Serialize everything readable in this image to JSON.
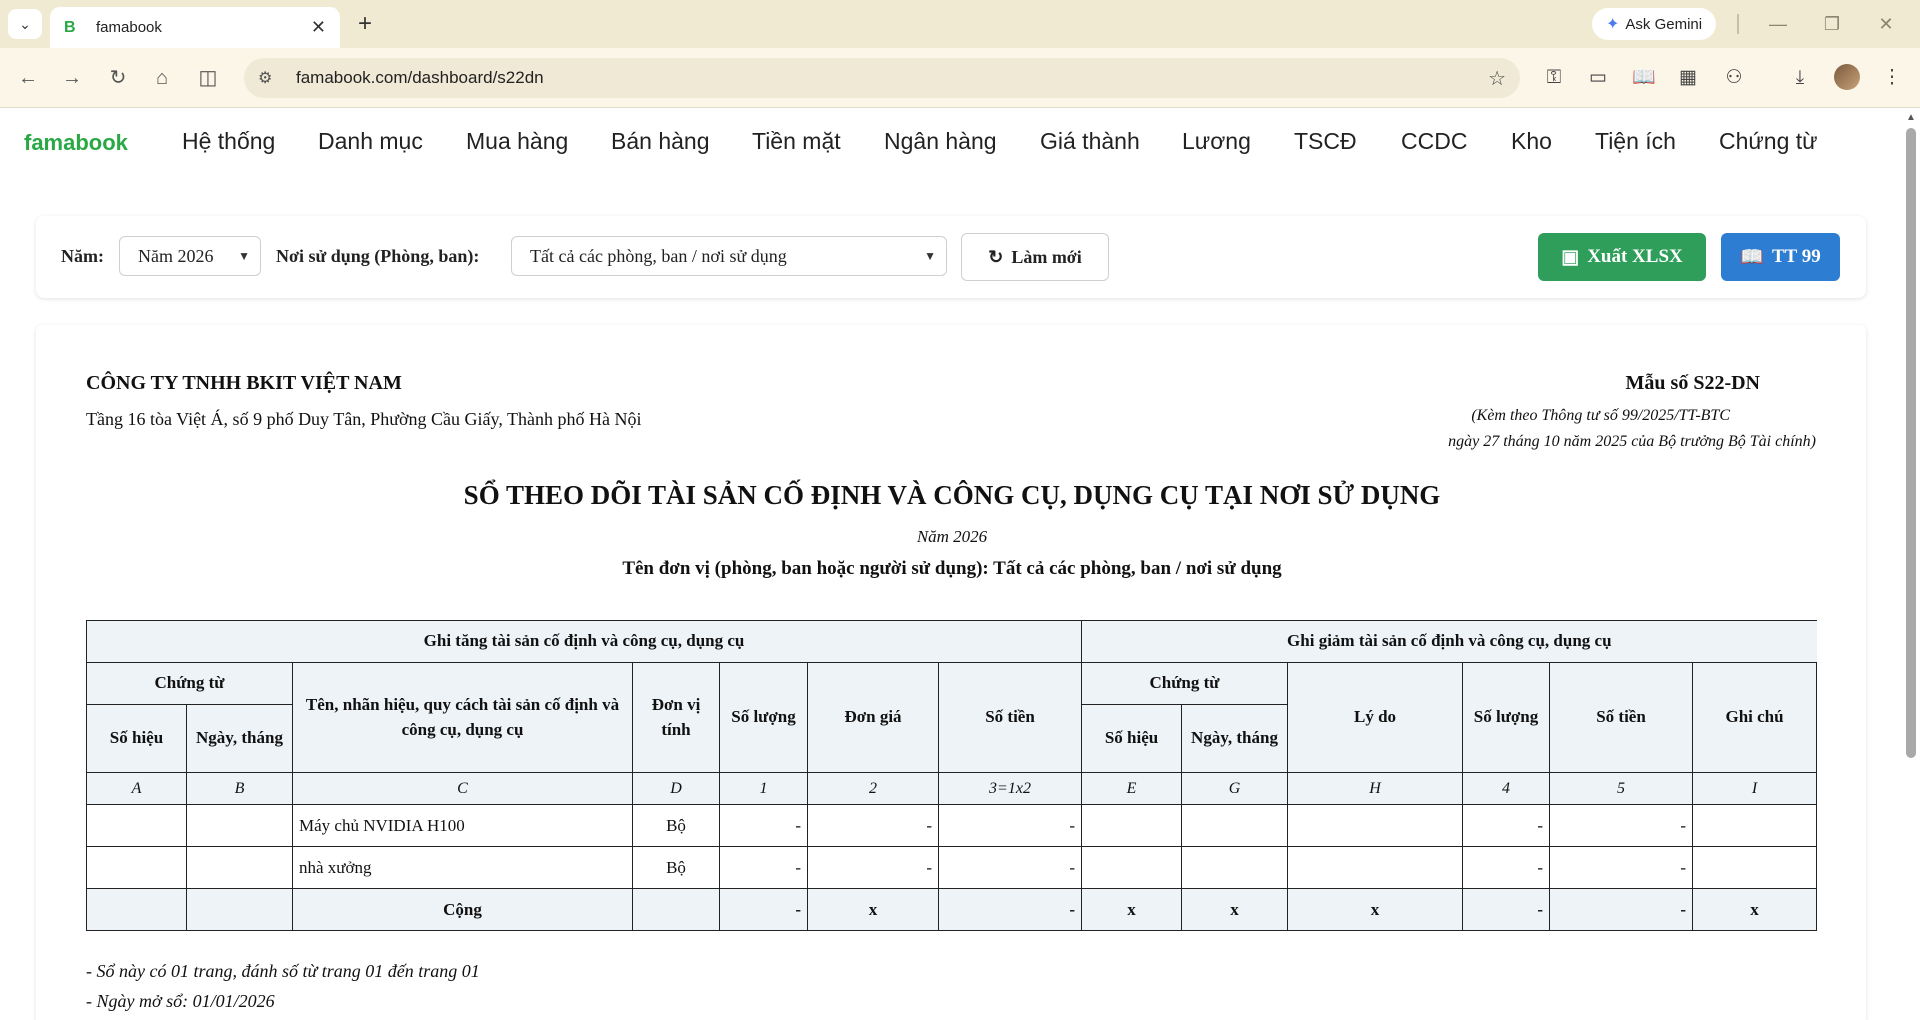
{
  "browser": {
    "tab_menu_icon": "chevron-down",
    "tab_favicon": "B",
    "tab_title": "famabook",
    "tab_close": "✕",
    "new_tab": "+",
    "gemini_label": "Ask Gemini",
    "url": "famabook.com/dashboard/s22dn"
  },
  "nav": {
    "brand": "famabook",
    "items": [
      "Hệ thống",
      "Danh mục",
      "Mua hàng",
      "Bán hàng",
      "Tiền mặt",
      "Ngân hàng",
      "Giá thành",
      "Lương",
      "TSCĐ",
      "CCDC",
      "Kho",
      "Tiện ích",
      "Chứng từ"
    ]
  },
  "filters": {
    "year_label": "Năm:",
    "year_value": "Năm 2026",
    "dept_label": "Nơi sử dụng (Phòng, ban):",
    "dept_value": "Tất cả các phòng, ban / nơi sử dụng",
    "refresh_label": "Làm mới",
    "export_label": "Xuất XLSX",
    "tt_label": "TT 99"
  },
  "report": {
    "company": "CÔNG TY TNHH BKIT VIỆT NAM",
    "address": "Tầng 16 tòa Việt Á, số 9 phố Duy Tân, Phường Cầu Giấy, Thành phố Hà Nội",
    "form_code": "Mẫu số S22-DN",
    "circular_line1": "(Kèm theo Thông tư số 99/2025/TT-BTC",
    "circular_line2": "ngày 27 tháng 10 năm 2025 của Bộ trưởng Bộ Tài chính)",
    "title": "SỔ THEO DÕI TÀI SẢN CỐ ĐỊNH VÀ CÔNG CỤ, DỤNG CỤ TẠI NƠI SỬ DỤNG",
    "year": "Năm 2026",
    "unit": "Tên đơn vị (phòng, ban hoặc người sử dụng): Tất cả các phòng, ban / nơi sử dụng",
    "headers": {
      "increase": "Ghi tăng tài sản cố định và công cụ, dụng cụ",
      "decrease": "Ghi giảm tài sản cố định và công cụ, dụng cụ",
      "note": "Ghi chú",
      "voucher": "Chứng từ",
      "number": "Số hiệu",
      "date": "Ngày, tháng",
      "name": "Tên, nhãn hiệu, quy cách tài sản cố định và công cụ, dụng cụ",
      "uom": "Đơn vị tính",
      "qty": "Số lượng",
      "price": "Đơn giá",
      "amount": "Số tiền",
      "reason": "Lý do"
    },
    "index_row": [
      "A",
      "B",
      "C",
      "D",
      "1",
      "2",
      "3=1x2",
      "E",
      "G",
      "H",
      "4",
      "5",
      "I"
    ],
    "rows": [
      {
        "inc_no": "",
        "inc_date": "",
        "name": "Máy chủ NVIDIA H100",
        "uom": "Bộ",
        "qty": "-",
        "price": "-",
        "amount": "-",
        "dec_no": "",
        "dec_date": "",
        "reason": "",
        "dec_qty": "-",
        "dec_amount": "-",
        "note": ""
      },
      {
        "inc_no": "",
        "inc_date": "",
        "name": "nhà xưởng",
        "uom": "Bộ",
        "qty": "-",
        "price": "-",
        "amount": "-",
        "dec_no": "",
        "dec_date": "",
        "reason": "",
        "dec_qty": "-",
        "dec_amount": "-",
        "note": ""
      }
    ],
    "total": {
      "label": "Cộng",
      "qty": "-",
      "price": "x",
      "amount": "-",
      "dec_no": "x",
      "dec_date": "x",
      "reason": "x",
      "dec_qty": "-",
      "dec_amount": "-",
      "note": "x"
    },
    "note_pages": "- Sổ này có 01 trang, đánh số từ trang 01 đến trang 01",
    "note_open_date": "- Ngày mở sổ: 01/01/2026"
  }
}
